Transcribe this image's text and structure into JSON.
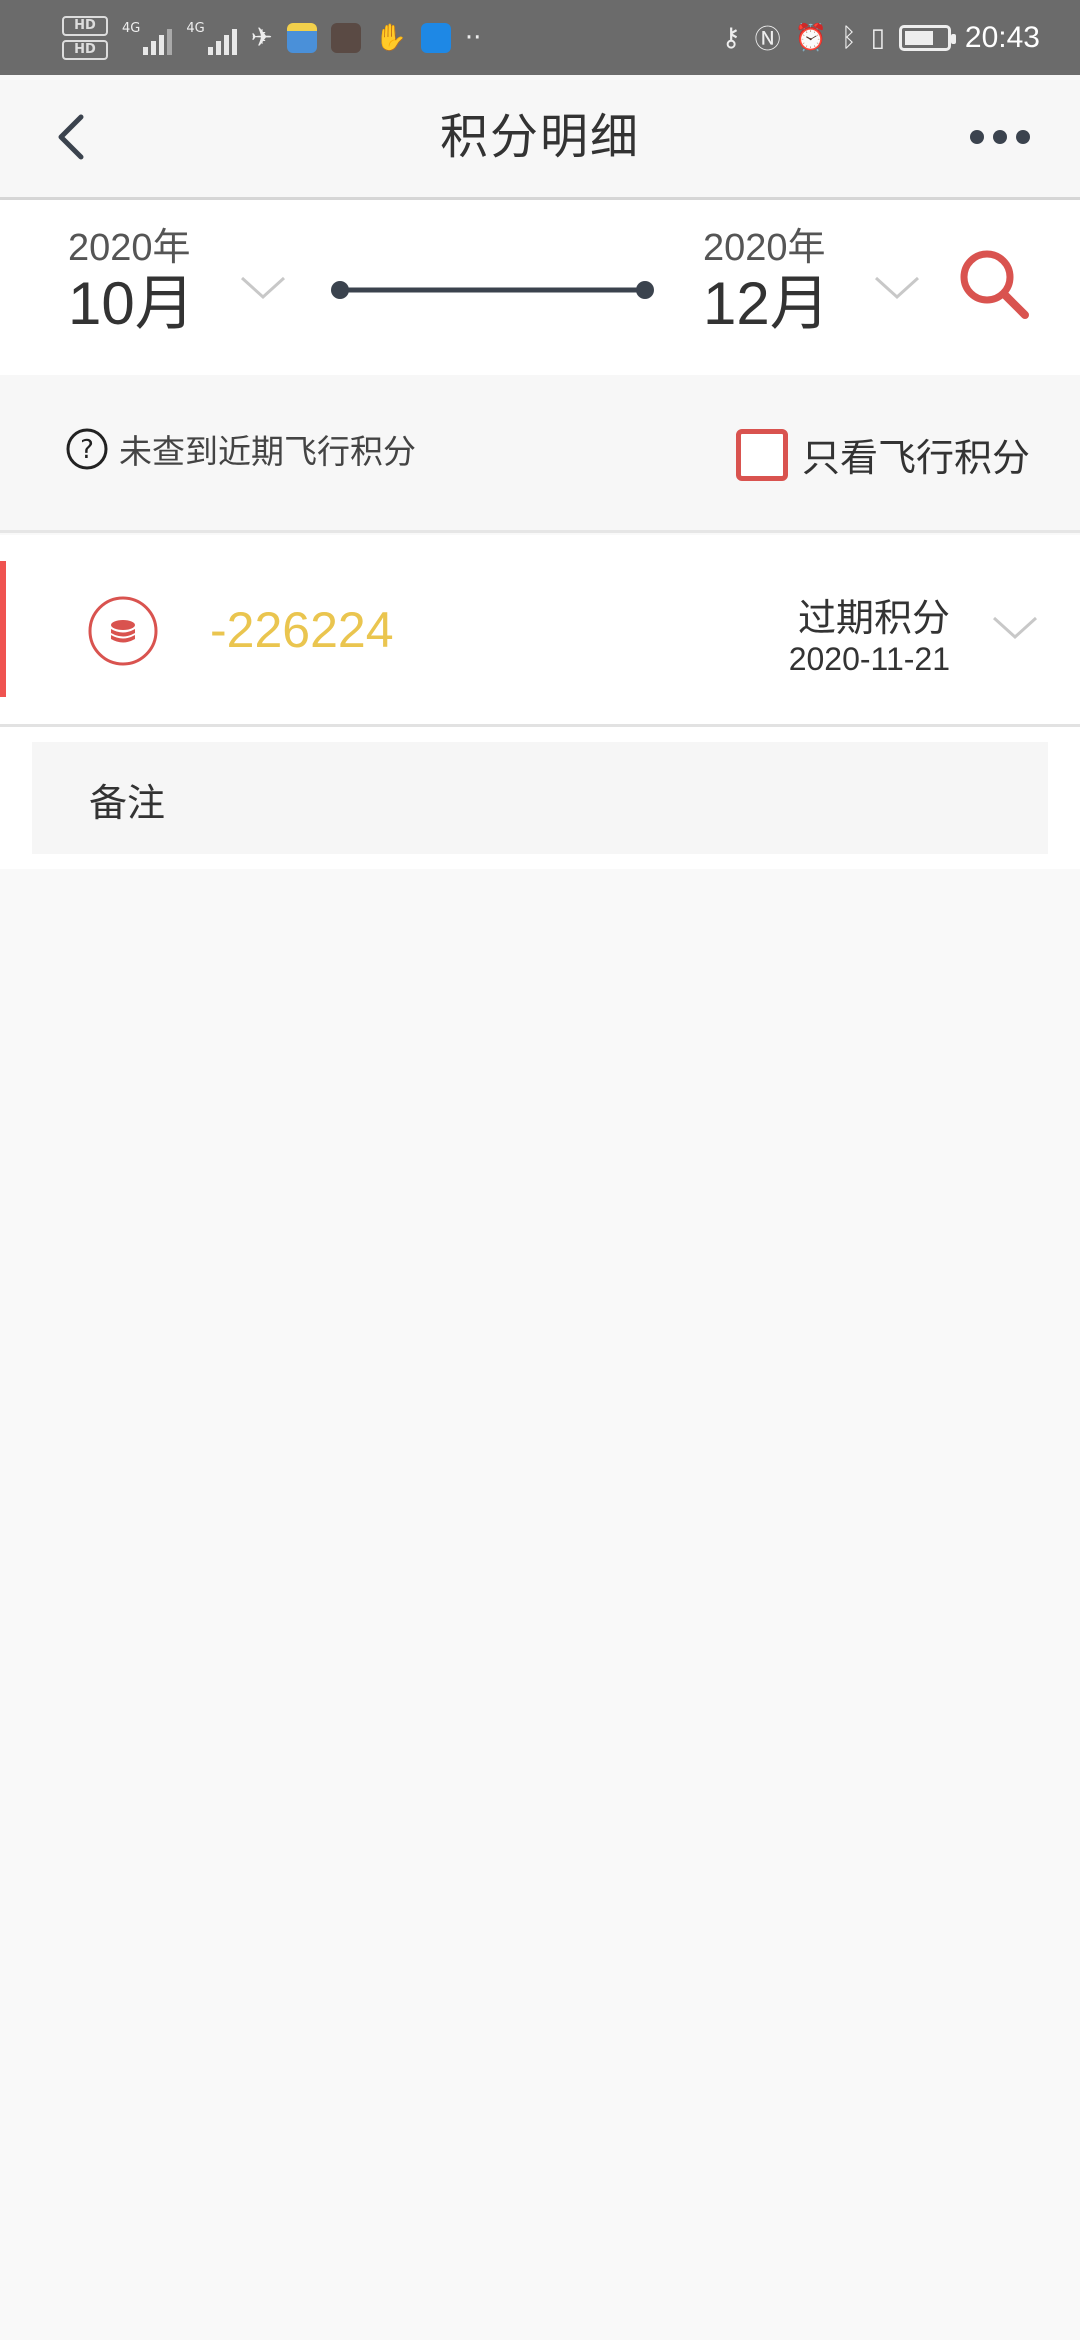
{
  "status_bar": {
    "time": "20:43",
    "hd1": "HD",
    "hd2": "HD",
    "net1": "4G",
    "net2": "4G"
  },
  "header": {
    "title": "积分明细"
  },
  "date_range": {
    "start_year": "2020年",
    "start_month": "10月",
    "end_year": "2020年",
    "end_month": "12月"
  },
  "filter": {
    "hint_text": "未查到近期飞行积分",
    "only_flight_label": "只看飞行积分",
    "only_flight_checked": false
  },
  "records": [
    {
      "points": "-226224",
      "type": "过期积分",
      "date": "2020-11-21"
    }
  ],
  "note": {
    "label": "备注"
  },
  "colors": {
    "accent_red": "#d9534f",
    "points_yellow": "#eac54f",
    "nav_icon": "#3b434e"
  },
  "icons": {
    "back": "chevron-left-icon",
    "more": "more-dots-icon",
    "search": "search-icon",
    "help": "question-circle-icon",
    "coin": "coin-stack-icon",
    "dropdown": "chevron-down-icon"
  }
}
